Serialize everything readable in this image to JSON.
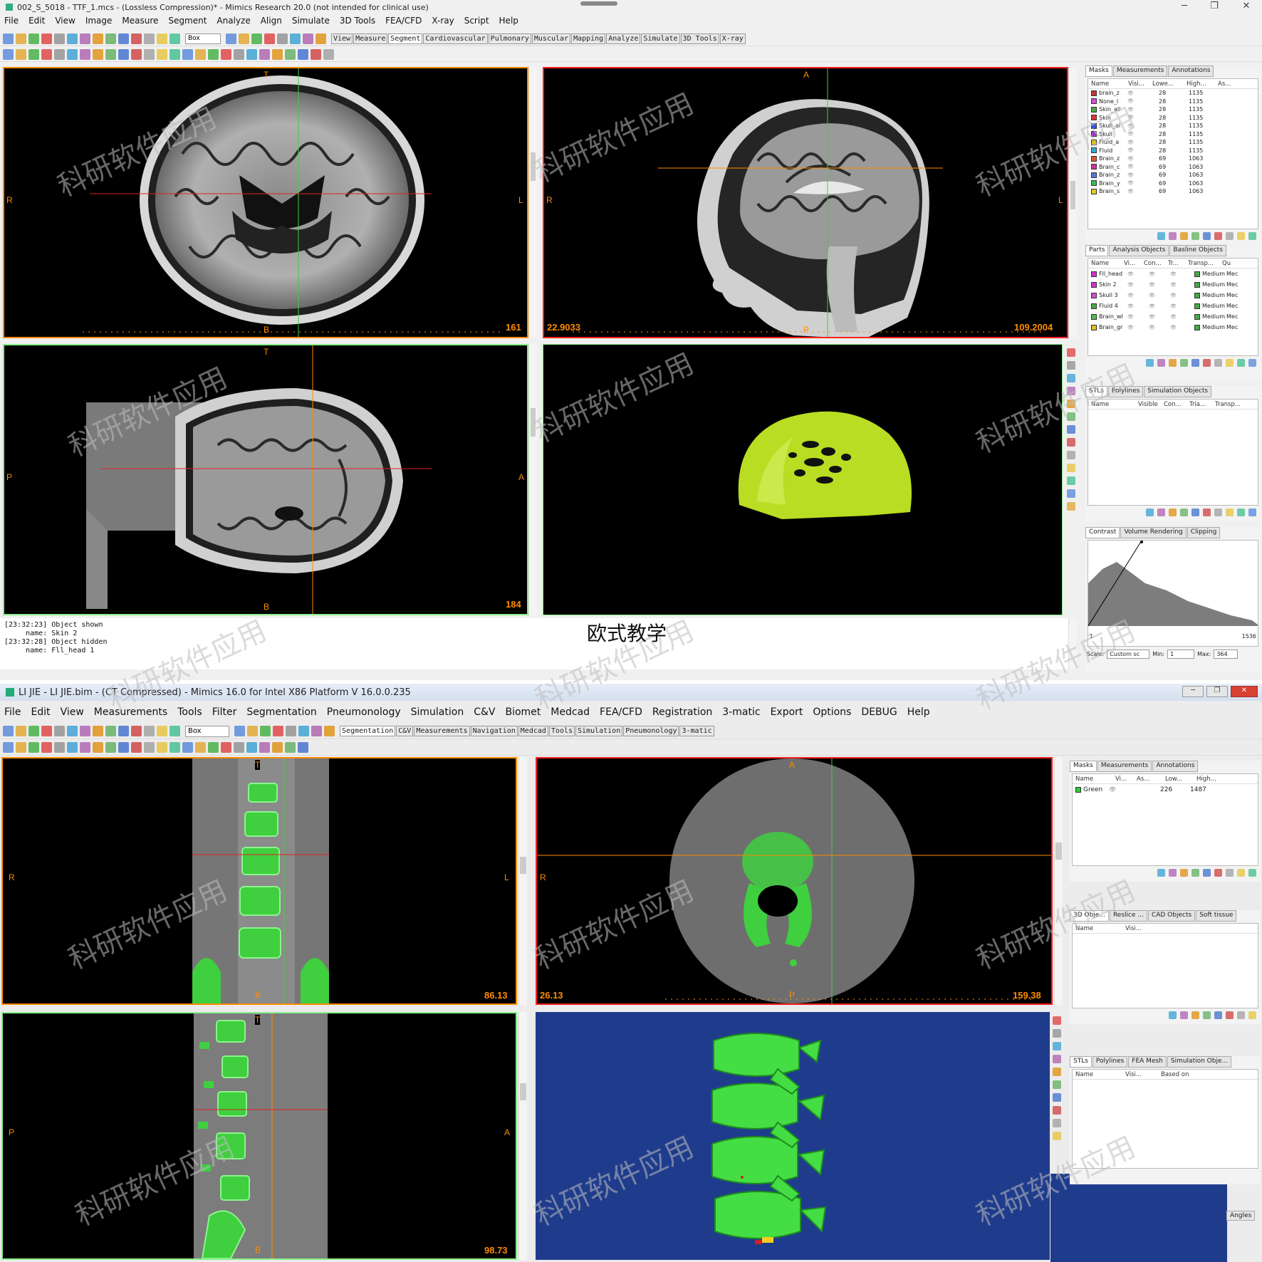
{
  "top": {
    "title": "002_S_5018 - TTF_1.mcs - (Lossless Compression)* - Mimics Research 20.0 (not intended for clinical use)",
    "menu": [
      "File",
      "Edit",
      "View",
      "Image",
      "Measure",
      "Segment",
      "Analyze",
      "Align",
      "Simulate",
      "3D Tools",
      "FEA/CFD",
      "X-ray",
      "Script",
      "Help"
    ],
    "dropdown": "Box",
    "tabs": [
      "View",
      "Measure",
      "Segment",
      "Cardiovascular",
      "Pulmonary",
      "Muscular",
      "Mapping",
      "Analyze",
      "Simulate",
      "3D Tools",
      "X-ray"
    ],
    "active_tab": "Segment",
    "views": {
      "axial": {
        "top": "T",
        "left": "R",
        "right": "L",
        "bottom": "B",
        "slice": "161"
      },
      "sagittal": {
        "top": "A",
        "left": "R",
        "right": "L",
        "bottom": "P",
        "left_value": "22.9033",
        "slice": "109.2004"
      },
      "coronal": {
        "top": "T",
        "left": "P",
        "right": "A",
        "bottom": "B",
        "slice": "184"
      }
    },
    "masks_panel": {
      "tabs": [
        "Masks",
        "Measurements",
        "Annotations"
      ],
      "headers": [
        "Name",
        "Visi...",
        "Lowe...",
        "High...",
        "As..."
      ],
      "rows": [
        {
          "name": "brain_z",
          "low": "28",
          "high": "1135",
          "color": "#cc3333"
        },
        {
          "name": "None_l",
          "low": "28",
          "high": "1135",
          "color": "#d64fd6"
        },
        {
          "name": "Skin_all",
          "low": "28",
          "high": "1135",
          "color": "#44aa44"
        },
        {
          "name": "Skin",
          "low": "28",
          "high": "1135",
          "color": "#dd3333"
        },
        {
          "name": "Skull_al",
          "low": "28",
          "high": "1135",
          "color": "#3355dd"
        },
        {
          "name": "Skull",
          "low": "28",
          "high": "1135",
          "color": "#aa33cc"
        },
        {
          "name": "Fluid_a",
          "low": "28",
          "high": "1135",
          "color": "#e0c020"
        },
        {
          "name": "Fluid",
          "low": "28",
          "high": "1135",
          "color": "#33aacc"
        },
        {
          "name": "Brain_z",
          "low": "69",
          "high": "1063",
          "color": "#dd5533"
        },
        {
          "name": "Brain_c",
          "low": "69",
          "high": "1063",
          "color": "#cc3399"
        },
        {
          "name": "Brain_z",
          "low": "69",
          "high": "1063",
          "color": "#5577dd"
        },
        {
          "name": "Brain_y",
          "low": "69",
          "high": "1063",
          "color": "#33bb55"
        },
        {
          "name": "Brain_s",
          "low": "69",
          "high": "1063",
          "color": "#ddcc22"
        }
      ]
    },
    "parts_panel": {
      "tabs": [
        "Parts",
        "Analysis Objects",
        "Basline Objects"
      ],
      "headers": [
        "Name",
        "Vi...",
        "Con...",
        "Tr...",
        "Transp...",
        "Qu"
      ],
      "rows": [
        {
          "name": "Fll_head",
          "quality": "Medium",
          "q2": "Mec",
          "color": "#cc33cc"
        },
        {
          "name": "Skin 2",
          "quality": "Medium",
          "q2": "Mec",
          "color": "#cc33cc"
        },
        {
          "name": "Skull 3",
          "quality": "Medium",
          "q2": "Mec",
          "color": "#d04fd0"
        },
        {
          "name": "Fluid 4",
          "quality": "Medium",
          "q2": "Mec",
          "color": "#44aa44"
        },
        {
          "name": "Brain_wl",
          "quality": "Medium",
          "q2": "Mec",
          "color": "#55bb55"
        },
        {
          "name": "Brain_gr",
          "quality": "Medium",
          "q2": "Mec",
          "color": "#e0c020"
        }
      ]
    },
    "stl_panel": {
      "tabs": [
        "STLs",
        "Polylines",
        "Simulation Objects"
      ],
      "headers": [
        "Name",
        "Visible",
        "Con...",
        "Tria...",
        "Transp..."
      ]
    },
    "contrast_panel": {
      "tabs": [
        "Contrast",
        "Volume Rendering",
        "Clipping"
      ],
      "axis_min": "1",
      "axis_max": "1536",
      "scale_label": "Scale:",
      "scale_value": "Custom sc",
      "min_label": "Min:",
      "min_value": "1",
      "max_label": "Max:",
      "max_value": "364"
    },
    "log": "[23:32:23] Object shown\n     name: Skin 2\n[23:32:28] Object hidden\n     name: Fll_head 1"
  },
  "caption": "欧式教学",
  "bottom": {
    "title": "LI JIE - LI JIE.bim - (CT Compressed) - Mimics 16.0 for Intel X86 Platform V 16.0.0.235",
    "menu": [
      "File",
      "Edit",
      "View",
      "Measurements",
      "Tools",
      "Filter",
      "Segmentation",
      "Pneumonology",
      "Simulation",
      "C&V",
      "Biomet",
      "Medcad",
      "FEA/CFD",
      "Registration",
      "3-matic",
      "Export",
      "Options",
      "DEBUG",
      "Help"
    ],
    "dropdown": "Box",
    "tabs": [
      "Segmentation",
      "C&V",
      "Measurements",
      "Navigation",
      "Medcad",
      "Tools",
      "Simulation",
      "Pneumonology",
      "3-matic"
    ],
    "active_tab": "Segmentation",
    "views": {
      "coronal": {
        "top": "T",
        "left": "R",
        "right": "L",
        "bottom": "B",
        "slice": "86.13"
      },
      "axial": {
        "top": "A",
        "left": "R",
        "bottom": "P",
        "left_value": "26.13",
        "slice": "159.38"
      },
      "sagittal": {
        "top": "T",
        "left": "P",
        "right": "A",
        "bottom": "B",
        "slice": "98.73"
      }
    },
    "masks_panel": {
      "tabs": [
        "Masks",
        "Measurements",
        "Annotations"
      ],
      "headers": [
        "Name",
        "Vi...",
        "As...",
        "Low...",
        "High..."
      ],
      "rows": [
        {
          "name": "Green",
          "low": "226",
          "high": "1487",
          "color": "#33cc33"
        }
      ]
    },
    "objects_panel": {
      "tabs": [
        "3D Obje...",
        "Reslice ...",
        "CAD Objects",
        "Soft tissue"
      ],
      "headers": [
        "Name",
        "Visi..."
      ]
    },
    "polyline_panel": {
      "tabs": [
        "STLs",
        "Polylines",
        "FEA Mesh",
        "Simulation Obje..."
      ],
      "headers": [
        "Name",
        "Visi...",
        "Based on"
      ]
    },
    "angles_tab": "Angles"
  },
  "watermark": "科研软件应用",
  "colors": {
    "accent_orange": "#ff8c00",
    "view_border_orange": "#ff8c00",
    "view_border_red": "#ff2020",
    "view_border_green": "#88ee88",
    "mesh_green": "#44dd44",
    "head_yellow": "#b8dd22",
    "bg_blue": "#1f3c8c"
  }
}
